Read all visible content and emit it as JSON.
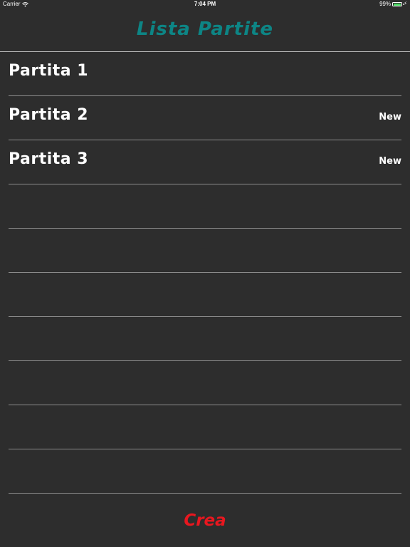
{
  "status_bar": {
    "carrier": "Carrier",
    "wifi_icon": "wifi-icon",
    "time": "7:04 PM",
    "battery_percent": "99%",
    "battery_level": 0.99,
    "battery_icon": "battery-icon",
    "charging_icon": "bolt-icon"
  },
  "nav": {
    "title": "Lista Partite",
    "title_color": "#0d8585"
  },
  "list": {
    "rows": [
      {
        "title": "Partita 1",
        "badge": ""
      },
      {
        "title": "Partita 2",
        "badge": "New"
      },
      {
        "title": "Partita 3",
        "badge": "New"
      },
      {
        "title": "",
        "badge": ""
      },
      {
        "title": "",
        "badge": ""
      },
      {
        "title": "",
        "badge": ""
      },
      {
        "title": "",
        "badge": ""
      },
      {
        "title": "",
        "badge": ""
      },
      {
        "title": "",
        "badge": ""
      },
      {
        "title": "",
        "badge": ""
      }
    ]
  },
  "footer": {
    "create_label": "Crea",
    "create_color": "#e8171f"
  },
  "colors": {
    "background": "#2d2d2d",
    "separator": "#8c8c8c",
    "text": "#ffffff",
    "battery_fill": "#4cd964"
  }
}
